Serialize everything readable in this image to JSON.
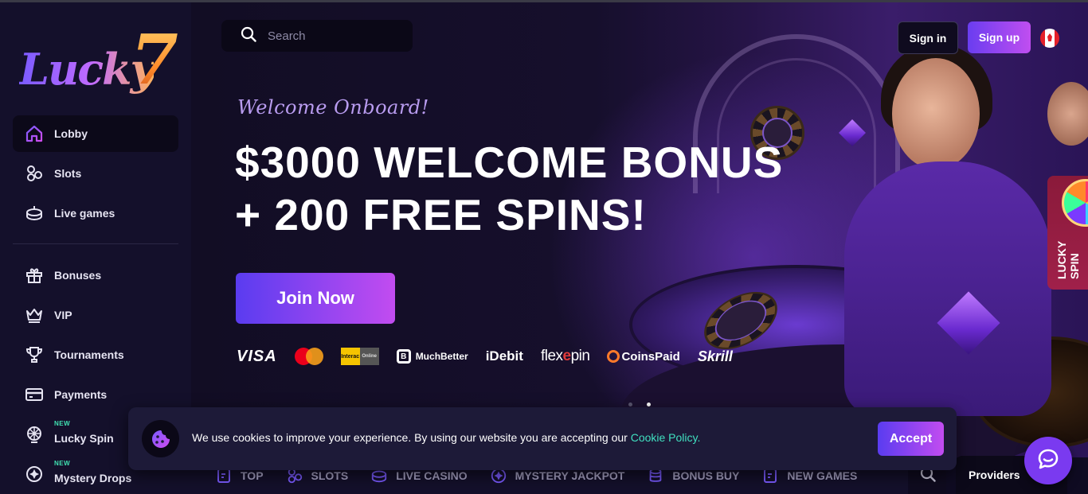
{
  "brand": {
    "logo_text": "Lucky",
    "logo_number": "7"
  },
  "sidebar": {
    "primary": [
      {
        "label": "Lobby",
        "icon": "home-icon"
      },
      {
        "label": "Slots",
        "icon": "slots-icon"
      },
      {
        "label": "Live games",
        "icon": "live-games-icon"
      }
    ],
    "secondary": [
      {
        "label": "Bonuses",
        "icon": "gift-icon"
      },
      {
        "label": "VIP",
        "icon": "crown-icon"
      },
      {
        "label": "Tournaments",
        "icon": "trophy-icon"
      },
      {
        "label": "Payments",
        "icon": "card-icon"
      },
      {
        "label": "Lucky Spin",
        "icon": "spin-wheel-icon",
        "badge": "NEW"
      },
      {
        "label": "Mystery Drops",
        "icon": "mystery-drops-icon",
        "badge": "NEW"
      }
    ]
  },
  "header": {
    "search_placeholder": "Search",
    "signin_label": "Sign in",
    "signup_label": "Sign up",
    "flag": "canada-flag-icon"
  },
  "hero": {
    "welcome": "Welcome Onboard!",
    "headline_line1": "$3000 WELCOME BONUS",
    "headline_line2": "+ 200 FREE SPINS!",
    "cta": "Join Now",
    "payments": {
      "visa": "VISA",
      "interac_left": "Interac",
      "interac_right": "Online",
      "muchbetter": "MuchBetter",
      "idebit": "iDebit",
      "flexepin_a": "flex",
      "flexepin_b": "e",
      "flexepin_c": "pin",
      "coinspaid": "CoinsPaid",
      "skrill": "Skrill"
    },
    "slides": 2,
    "active_slide": 2,
    "lucky_spin_tab": [
      "LUCKY",
      "SPIN"
    ]
  },
  "categories": [
    {
      "label": "TOP",
      "icon": "top-icon"
    },
    {
      "label": "SLOTS",
      "icon": "slots-icon"
    },
    {
      "label": "LIVE CASINO",
      "icon": "live-casino-icon"
    },
    {
      "label": "MYSTERY JACKPOT",
      "icon": "mystery-jackpot-icon"
    },
    {
      "label": "BONUS BUY",
      "icon": "bonus-buy-icon"
    },
    {
      "label": "NEW GAMES",
      "icon": "new-games-icon"
    }
  ],
  "providers_label": "Providers",
  "cookie": {
    "text": "We use cookies to improve your experience. By using our website you are accepting our ",
    "link": "Cookie Policy.",
    "accept": "Accept"
  },
  "colors": {
    "accent": "#7a3af0",
    "link": "#40e0c0",
    "sidebar_bg": "#14102b",
    "page_bg": "#0f0b22"
  }
}
